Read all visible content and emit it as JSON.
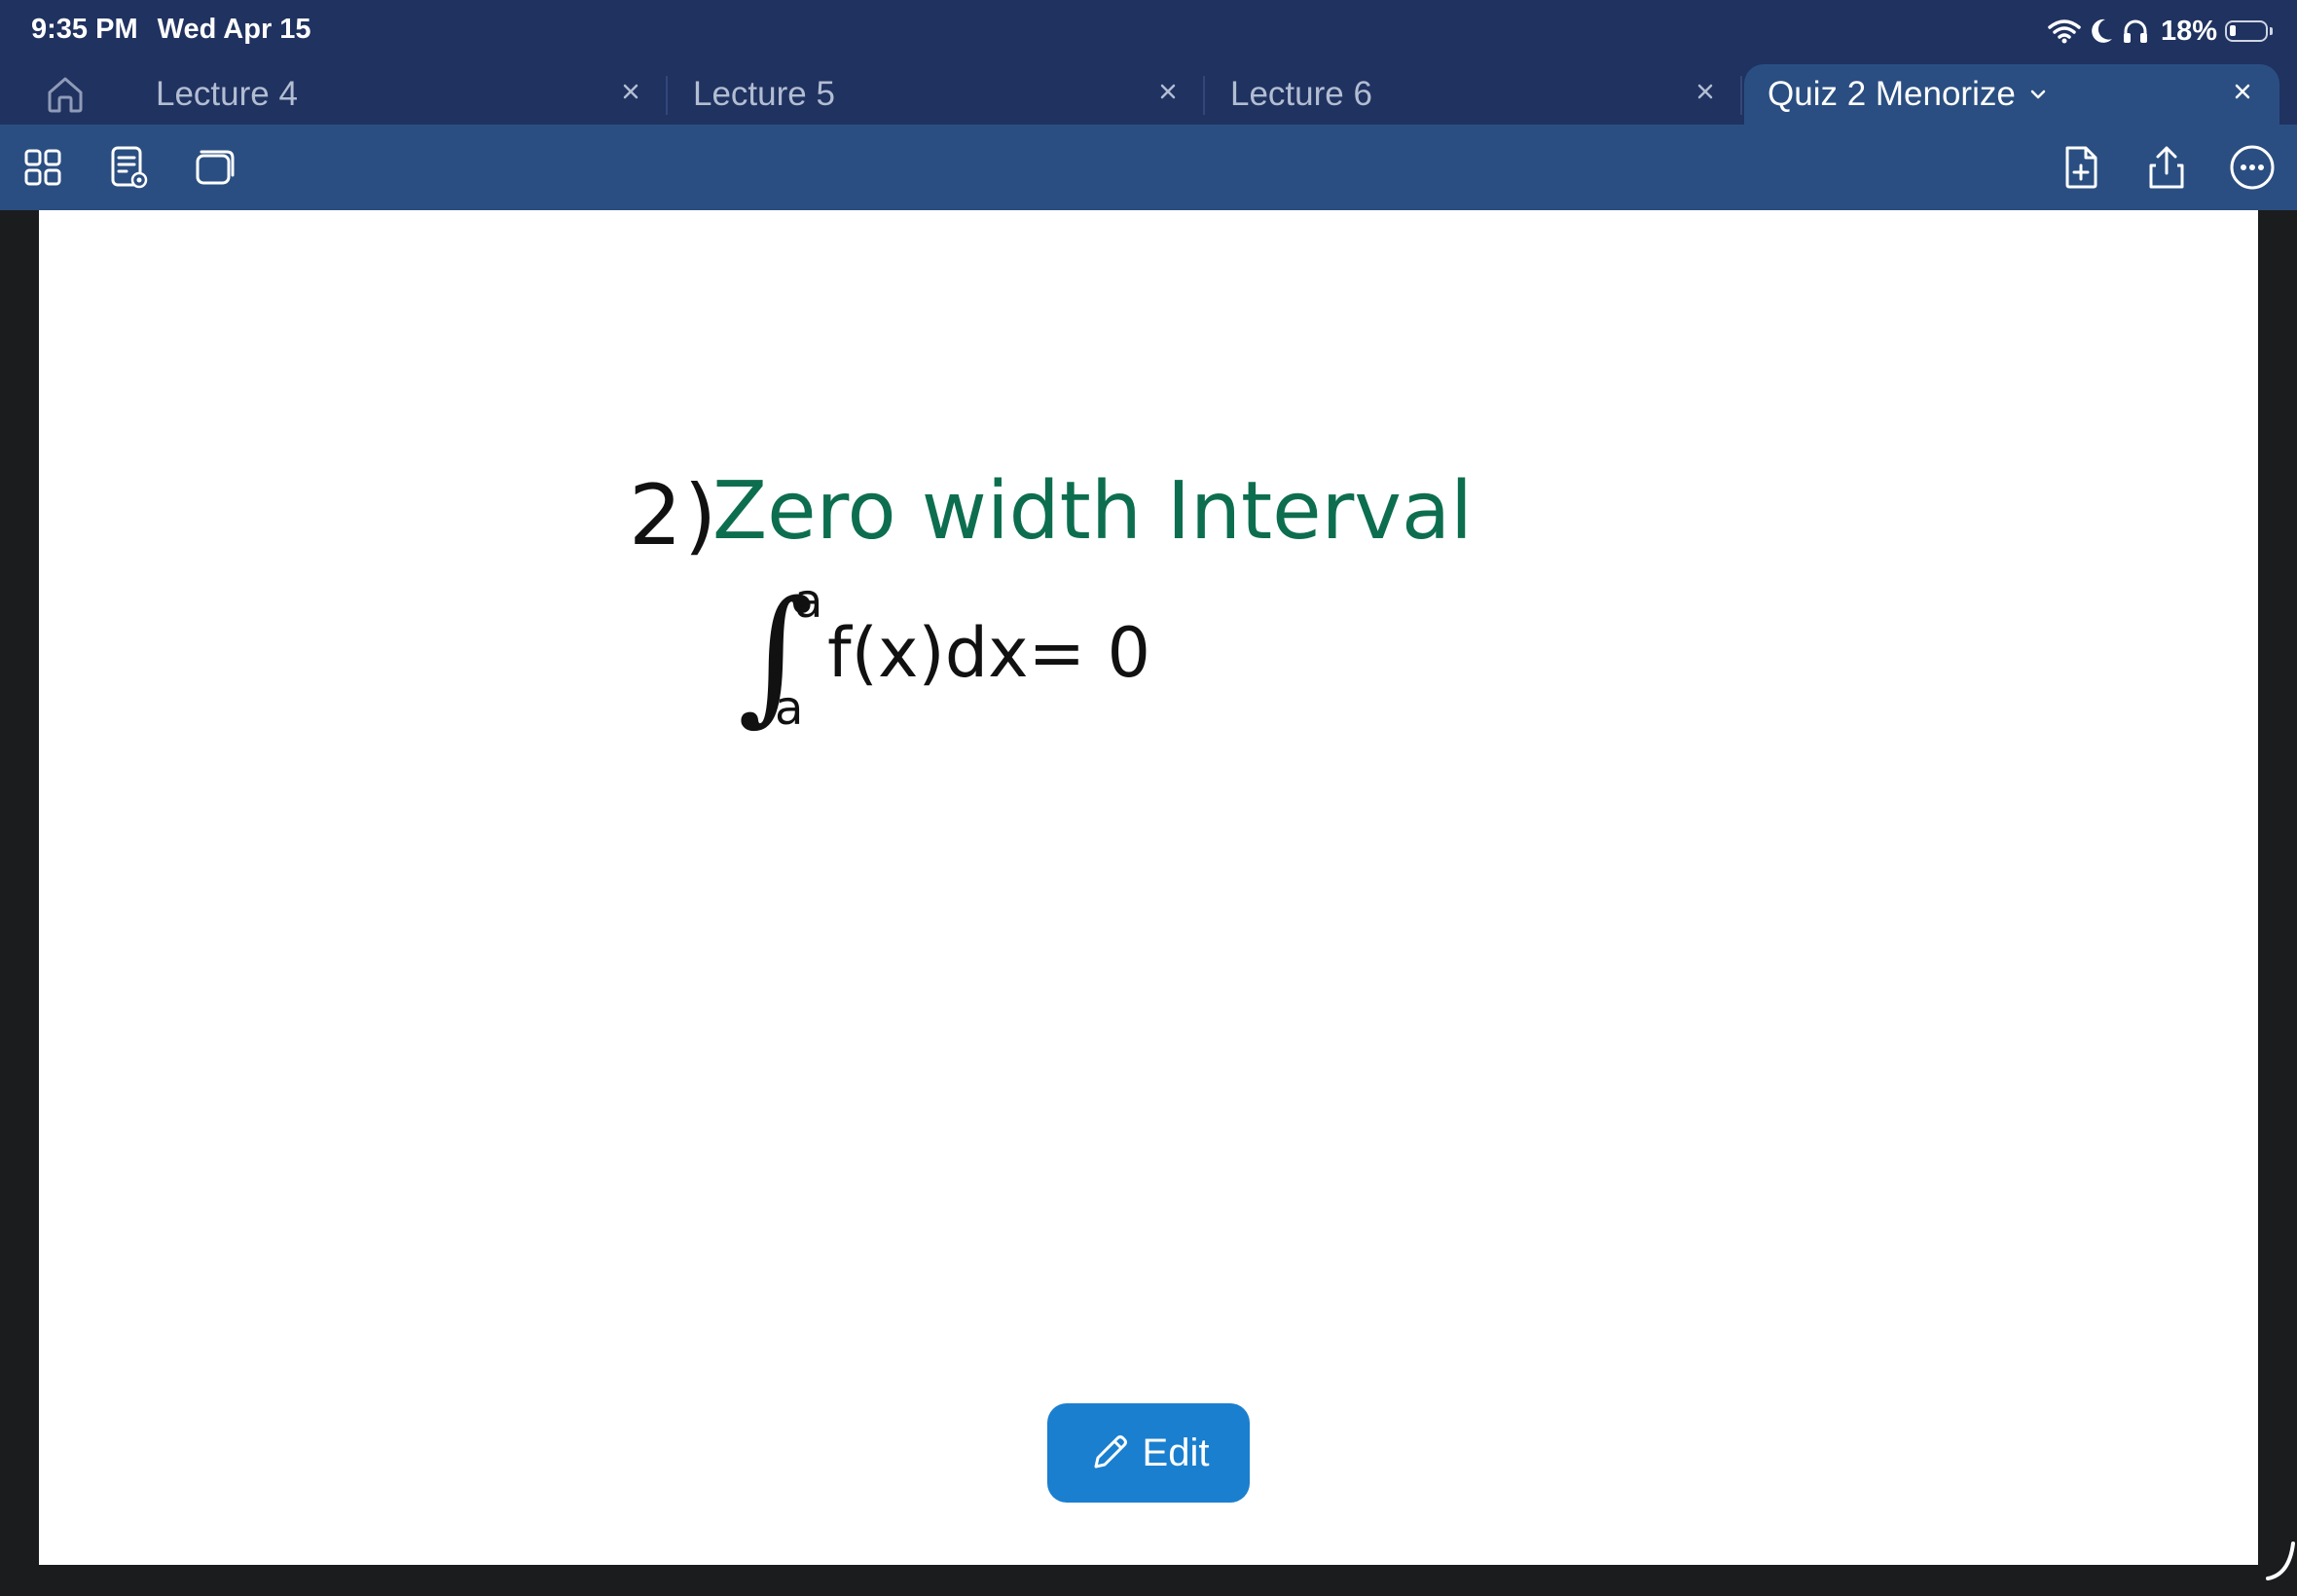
{
  "status_bar": {
    "time": "9:35 PM",
    "date": "Wed Apr 15",
    "battery_percent": "18%",
    "icons": [
      "wifi-icon",
      "moon-icon",
      "headphones-icon",
      "battery-icon"
    ]
  },
  "tabs": [
    {
      "label": "Lecture 4",
      "active": false
    },
    {
      "label": "Lecture 5",
      "active": false
    },
    {
      "label": "Lecture 6",
      "active": false
    },
    {
      "label": "Quiz 2 Menorize",
      "active": true
    }
  ],
  "toolbar": {
    "left_icons": [
      "grid-view-icon",
      "document-view-icon",
      "pages-icon"
    ],
    "right_icons": [
      "add-page-icon",
      "share-icon",
      "more-icon"
    ]
  },
  "note": {
    "number": "2)",
    "title": "Zero width Interval",
    "integral_upper": "a",
    "integral_lower": "a",
    "expression": "f(x)dx= 0"
  },
  "edit_button": {
    "label": "Edit"
  },
  "colors": {
    "topbar": "#1f3260",
    "toolbar": "#2a4e81",
    "title_ink": "#0d6e4f",
    "edit_button": "#1a7fcf"
  }
}
